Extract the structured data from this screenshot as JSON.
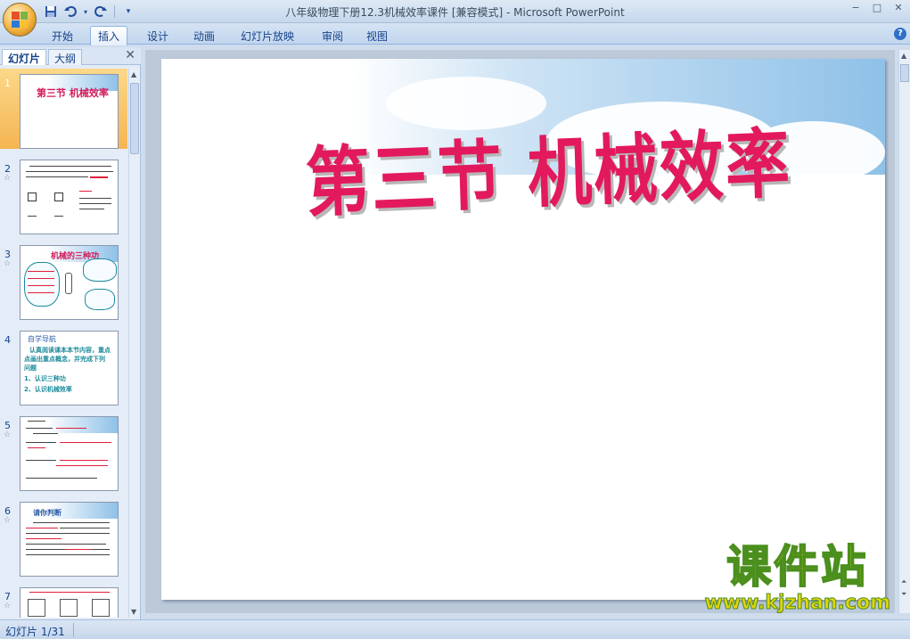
{
  "window": {
    "title": "八年级物理下册12.3机械效率课件 [兼容模式] - Microsoft PowerPoint",
    "controls": [
      "−",
      "□",
      "✕"
    ]
  },
  "quick_access": {
    "items": [
      "save-icon",
      "undo-icon",
      "redo-icon",
      "customize-icon"
    ]
  },
  "ribbon": {
    "tabs": [
      {
        "label": "开始",
        "active": false
      },
      {
        "label": "插入",
        "active": true
      },
      {
        "label": "设计",
        "active": false
      },
      {
        "label": "动画",
        "active": false
      },
      {
        "label": "幻灯片放映",
        "active": false
      },
      {
        "label": "审阅",
        "active": false
      },
      {
        "label": "视图",
        "active": false
      }
    ],
    "help_label": "?"
  },
  "left_pane": {
    "tabs": [
      {
        "label": "幻灯片",
        "active": true
      },
      {
        "label": "大纲",
        "active": false
      }
    ],
    "close_label": "✕",
    "thumbnails": [
      {
        "num": "1",
        "selected": true,
        "title": "第三节 机械效率"
      },
      {
        "num": "2",
        "selected": false,
        "title": ""
      },
      {
        "num": "3",
        "selected": false,
        "title": "机械的三种功"
      },
      {
        "num": "4",
        "selected": false,
        "title": "自学导航"
      },
      {
        "num": "5",
        "selected": false,
        "title": ""
      },
      {
        "num": "6",
        "selected": false,
        "title": "请你判断"
      },
      {
        "num": "7",
        "selected": false,
        "title": ""
      }
    ],
    "slide4_lines": [
      "认真阅读课本本节内容，重点",
      "点画出重点概念，并完成下列",
      "问题",
      "1、认识三种功",
      "2、认识机械效率"
    ]
  },
  "slide": {
    "title": "第三节  机械效率"
  },
  "watermark": {
    "brand": "课件站",
    "url": "www.kjzhan.com"
  },
  "status": {
    "slide_counter": "幻灯片 1/31"
  },
  "colors": {
    "title_red": "#e3195d",
    "watermark_yellow": "#e5d40a",
    "watermark_green": "#4b8f1e",
    "selected_thumb": "#f5b553"
  }
}
